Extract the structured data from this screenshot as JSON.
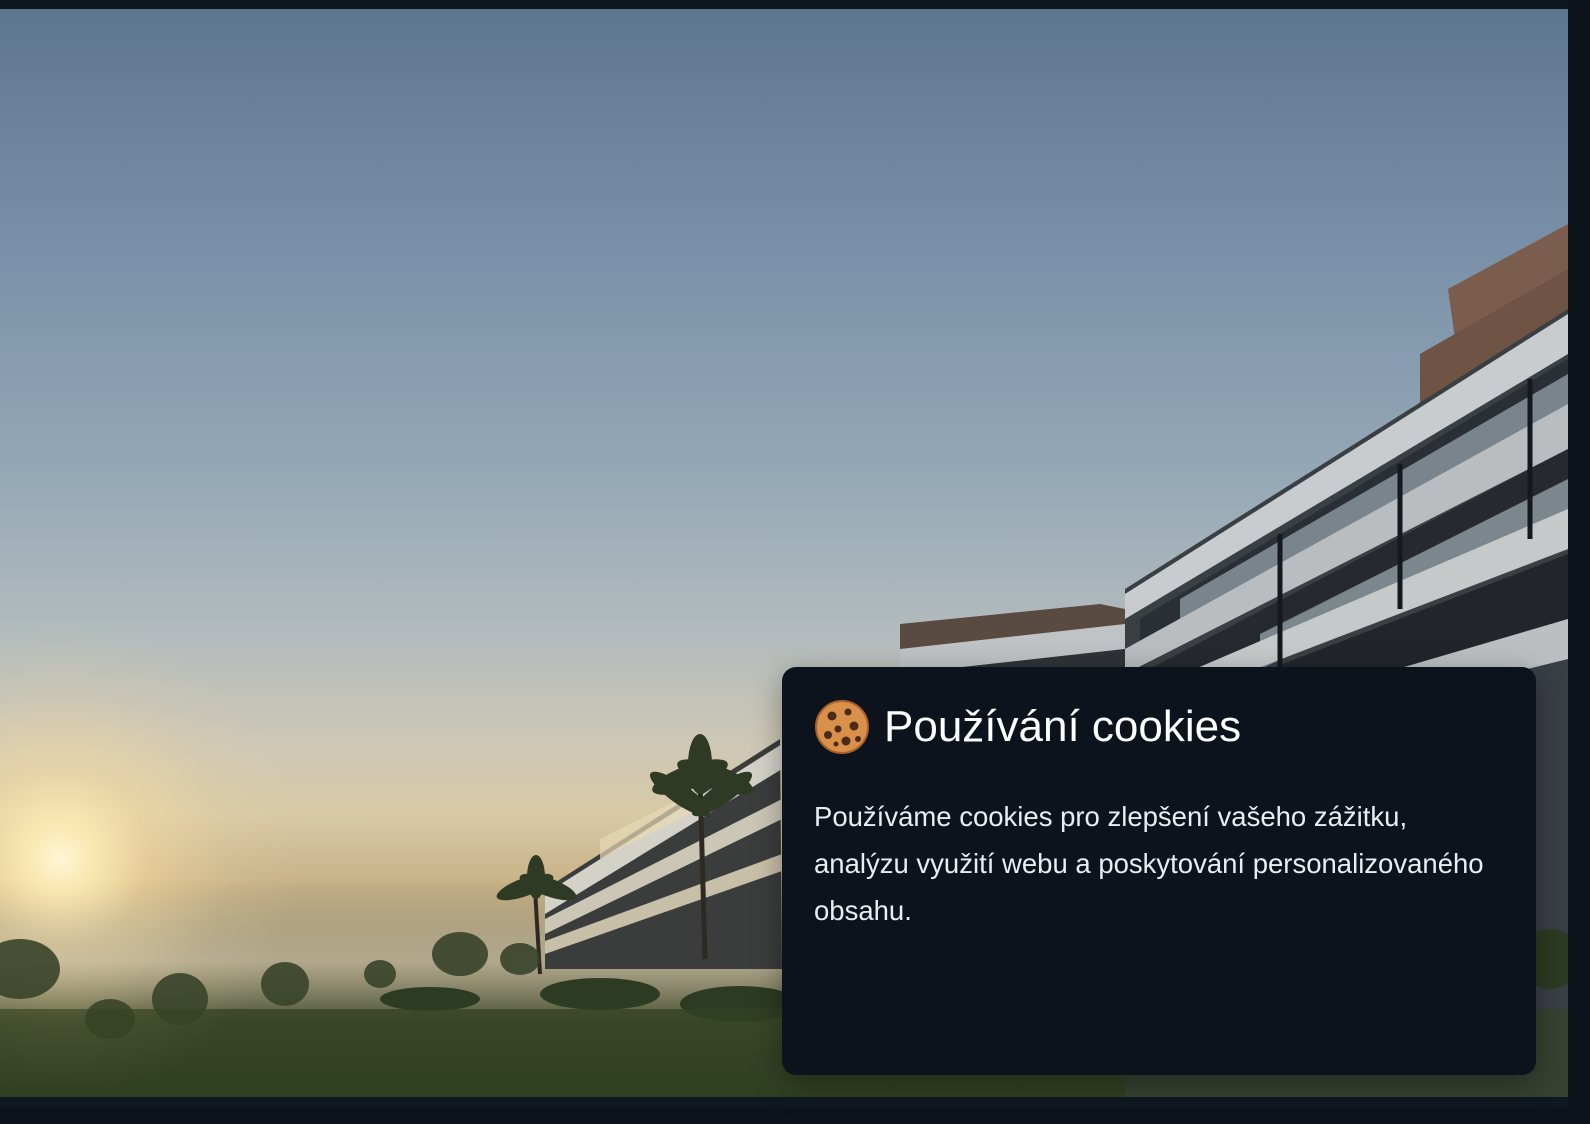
{
  "cookie_banner": {
    "title": "Používání cookies",
    "icon": "cookie-icon",
    "message": "Používáme cookies pro zlepšení vašeho zážitku, analýzu využití webu a poskytování personalizovaného obsahu."
  },
  "hero": {
    "image": "sunset-apartment-buildings-photo"
  },
  "colors": {
    "panel_background": "#0d131c",
    "panel_text": "#ffffff",
    "page_edge": "#0f1720"
  }
}
